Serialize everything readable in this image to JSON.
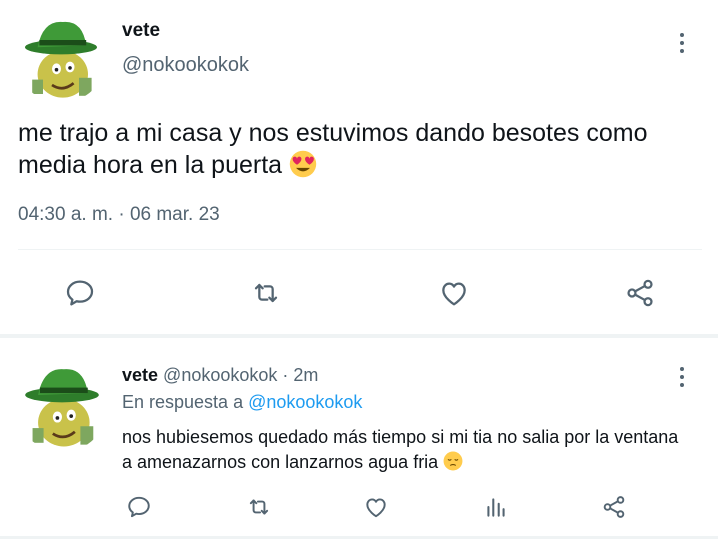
{
  "main_tweet": {
    "name": "vete",
    "handle": "@nokookokok",
    "text": "me trajo a mi casa y nos estuvimos dando besotes como media hora en la puerta",
    "text_emoji": "heart-eyes-emoji",
    "timestamp": "04:30 a. m. · 06 mar. 23",
    "actions": [
      "reply-icon",
      "retweet-icon",
      "like-icon",
      "share-icon"
    ]
  },
  "reply_tweet": {
    "name": "vete",
    "handle_time": "@nokookokok · 2m",
    "replying_prefix": "En respuesta a",
    "replying_handle": "@nokookokok",
    "text": "nos hubiesemos quedado más tiempo si mi tia no salia por la ventana a amenazarnos con lanzarnos agua fria",
    "text_emoji": "pensive-face-emoji",
    "actions": [
      "reply-icon",
      "retweet-icon",
      "like-icon",
      "analytics-icon",
      "share-icon"
    ]
  },
  "colors": {
    "text": "#0f1419",
    "secondary": "#536471",
    "link": "#1d9bf0",
    "divider": "#eff3f4"
  }
}
